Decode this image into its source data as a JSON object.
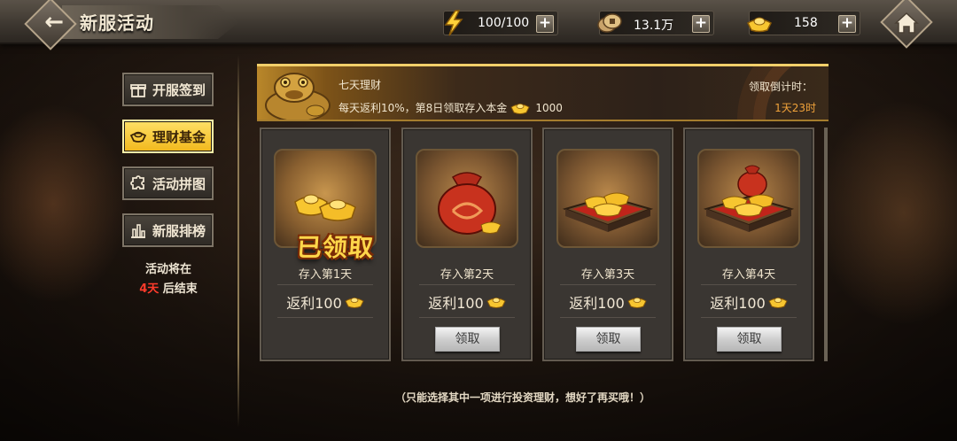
{
  "header": {
    "title": "新服活动"
  },
  "resources": [
    {
      "name": "stamina",
      "value": "100/100",
      "icon": "lightning-icon"
    },
    {
      "name": "copper-coins",
      "value": "13.1万",
      "icon": "coin-icon"
    },
    {
      "name": "gold-ingots",
      "value": "158",
      "icon": "gold-ingot-icon"
    }
  ],
  "sidebar": {
    "items": [
      {
        "label": "开服签到",
        "icon": "gift-icon",
        "active": false
      },
      {
        "label": "理财基金",
        "icon": "ingot-icon",
        "active": true
      },
      {
        "label": "活动拼图",
        "icon": "puzzle-icon",
        "active": false
      },
      {
        "label": "新服排榜",
        "icon": "rank-chart-icon",
        "active": false
      }
    ],
    "note_line1": "活动将在",
    "note_days": "4天",
    "note_line2": "后结束"
  },
  "banner": {
    "title": "七天理财",
    "desc": "每天返利10%，第8日领取存入本金",
    "amount": "1000",
    "countdown_label": "领取倒计时：",
    "countdown_value": "1天23时"
  },
  "cards": [
    {
      "day": "存入第1天",
      "reward": "返利100",
      "claimed": true,
      "stamp": "已领取"
    },
    {
      "day": "存入第2天",
      "reward": "返利100",
      "claimed": false,
      "button": "领取"
    },
    {
      "day": "存入第3天",
      "reward": "返利100",
      "claimed": false,
      "button": "领取"
    },
    {
      "day": "存入第4天",
      "reward": "返利100",
      "claimed": false,
      "button": "领取"
    }
  ],
  "footnote": "（只能选择其中一项进行投资理财，想好了再买哦！）",
  "colors": {
    "accent_gold": "#f1b81c",
    "countdown": "#f0a23a",
    "days_red": "#ff3b2b"
  }
}
